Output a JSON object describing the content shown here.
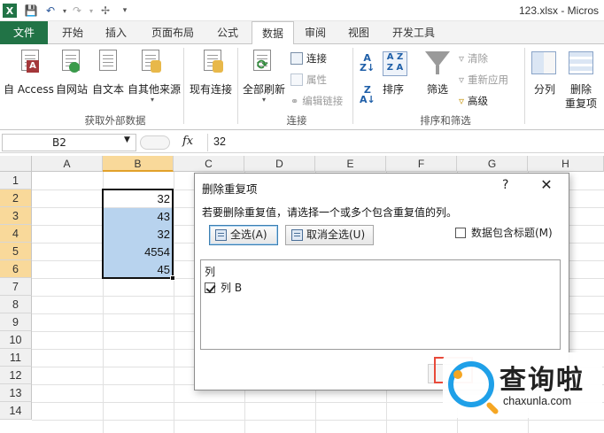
{
  "window": {
    "filename": "123.xlsx - Micros"
  },
  "quick_access": {
    "icons": [
      "excel-icon",
      "save-icon",
      "undo-icon",
      "redo-icon",
      "customize-icon"
    ]
  },
  "tabs": [
    {
      "label": "文件"
    },
    {
      "label": "开始"
    },
    {
      "label": "插入"
    },
    {
      "label": "页面布局"
    },
    {
      "label": "公式"
    },
    {
      "label": "数据"
    },
    {
      "label": "审阅"
    },
    {
      "label": "视图"
    },
    {
      "label": "开发工具"
    }
  ],
  "ribbon": {
    "get_external": {
      "access": "自 Access",
      "web": "自网站",
      "text": "自文本",
      "other": "自其他来源",
      "existing": "现有连接",
      "group_label": "获取外部数据"
    },
    "connections": {
      "refresh_all": "全部刷新",
      "connections": "连接",
      "properties": "属性",
      "edit_links": "编辑链接",
      "group_label": "连接"
    },
    "sort_filter": {
      "sort": "排序",
      "filter": "筛选",
      "clear": "清除",
      "reapply": "重新应用",
      "advanced": "高级",
      "group_label": "排序和筛选"
    },
    "data_tools": {
      "split": "分列",
      "remove_dup": "删除",
      "remove_dup2": "重复项"
    }
  },
  "formula_bar": {
    "name_box": "B2",
    "fx": "fx",
    "value": "32"
  },
  "grid": {
    "columns": [
      "A",
      "B",
      "C",
      "D",
      "E",
      "F",
      "G",
      "H"
    ],
    "rows": [
      "1",
      "2",
      "3",
      "4",
      "5",
      "6",
      "7",
      "8",
      "9",
      "10",
      "11",
      "12",
      "13",
      "14"
    ],
    "b_values": [
      "32",
      "43",
      "32",
      "4554",
      "45"
    ]
  },
  "dialog": {
    "title": "删除重复项",
    "help": "?",
    "close": "✕",
    "instruction": "若要删除重复值，请选择一个或多个包含重复值的列。",
    "select_all": "全选(A)",
    "unselect_all": "取消全选(U)",
    "header_checkbox": "数据包含标题(M)",
    "list_header": "列",
    "items": [
      {
        "label": "列 B",
        "checked": true
      }
    ]
  },
  "watermark": {
    "cn": "查询啦",
    "en": "chaxunla.com"
  }
}
